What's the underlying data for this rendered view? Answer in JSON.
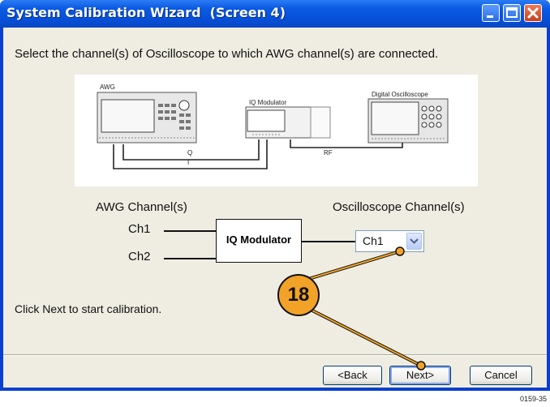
{
  "window": {
    "title": "System Calibration Wizard  (Screen 4)"
  },
  "main": {
    "instruction": "Select the channel(s) of Oscilloscope to which AWG channel(s) are connected.",
    "illustration": {
      "awg_label": "AWG",
      "iq_label": "IQ Modulator",
      "scope_label": "Digital Oscilloscope",
      "q_label": "Q",
      "i_label": "I",
      "rf_label": "RF"
    },
    "diagram": {
      "awg_heading": "AWG Channel(s)",
      "ch1": "Ch1",
      "ch2": "Ch2",
      "modulator": "IQ Modulator",
      "scope_heading": "Oscilloscope Channel(s)",
      "scope_channel_value": "Ch1"
    },
    "hint": "Click Next to start calibration."
  },
  "buttons": {
    "back": "<Back",
    "next": "Next>",
    "cancel": "Cancel"
  },
  "callout": {
    "number": "18"
  },
  "figure_id": "0159-35",
  "colors": {
    "titlebar": "#0b5ae4",
    "callout": "#f2a327"
  }
}
